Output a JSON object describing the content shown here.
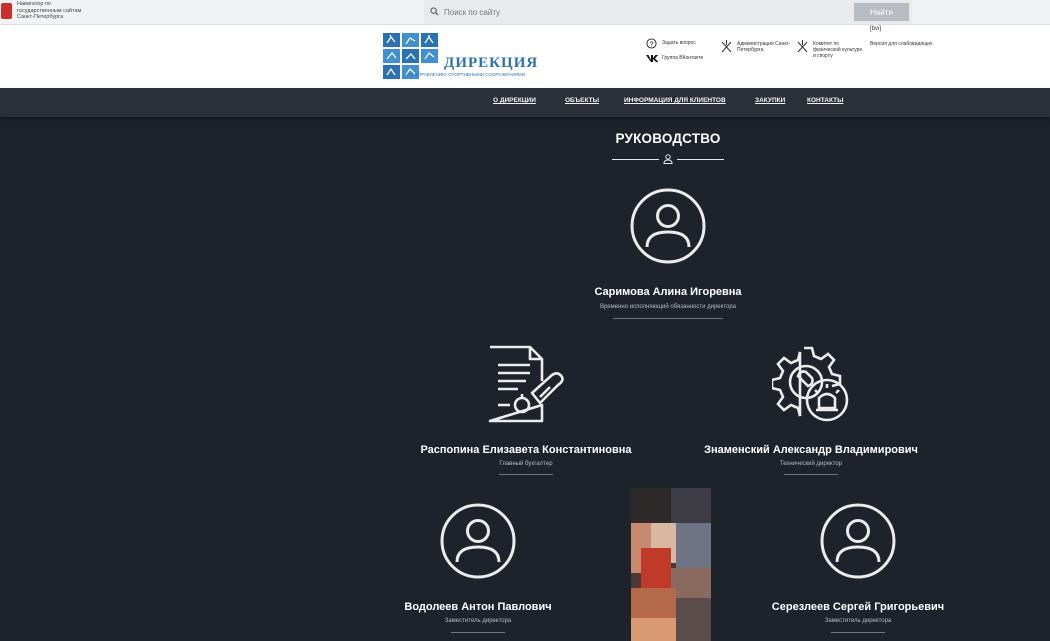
{
  "topbar": {
    "gov_navigator": "Навигатор по государственным сайтам Санкт-Петербурга",
    "search_placeholder": "Поиск по сайту",
    "search_button": "Найти"
  },
  "header": {
    "logo_title": "ДИРЕКЦИЯ",
    "logo_subtitle": "ПО УПРАВЛЕНИЮ СПОРТИВНЫМИ СООРУЖЕНИЯМИ",
    "ask_question": "Задать вопрос",
    "vk_group": "Группа ВКонтакте",
    "administration": "Администрация Санкт-Петербурга",
    "committee": "Комитет по физической культуре и спорту",
    "bvi": "[bvi]",
    "low_vision": "Версия для слабовидящих"
  },
  "nav": {
    "items": [
      {
        "label": "О ДИРЕКЦИИ"
      },
      {
        "label": "ОБЪЕКТЫ"
      },
      {
        "label": "ИНФОРМАЦИЯ ДЛЯ КЛИЕНТОВ"
      },
      {
        "label": "ЗАКУПКИ"
      },
      {
        "label": "КОНТАКТЫ"
      }
    ]
  },
  "section": {
    "title": "РУКОВОДСТВО"
  },
  "people": [
    {
      "name": "Саримова Алина Игоревна",
      "role": "Временно исполняющий обязанности директора",
      "icon": "user-circle-icon"
    },
    {
      "name": "Распопина Елизавета Константиновна",
      "role": "Главный бухгалтер",
      "icon": "document-stamp-icon"
    },
    {
      "name": "Знаменский Александр Владимирович",
      "role": "Технический директор",
      "icon": "gear-wrench-icon"
    },
    {
      "name": "Водолеев Антон Павлович",
      "role": "Заместитель директора",
      "icon": "user-circle-icon"
    },
    {
      "name": "Серезлеев Сергей Григорьевич",
      "role": "Заместитель директора",
      "icon": "user-circle-icon"
    }
  ],
  "colors": {
    "page_bg": "#1d222b",
    "nav_bg": "#2b2f38",
    "brand_blue": "#2a72b5",
    "text_white": "#ffffff"
  }
}
